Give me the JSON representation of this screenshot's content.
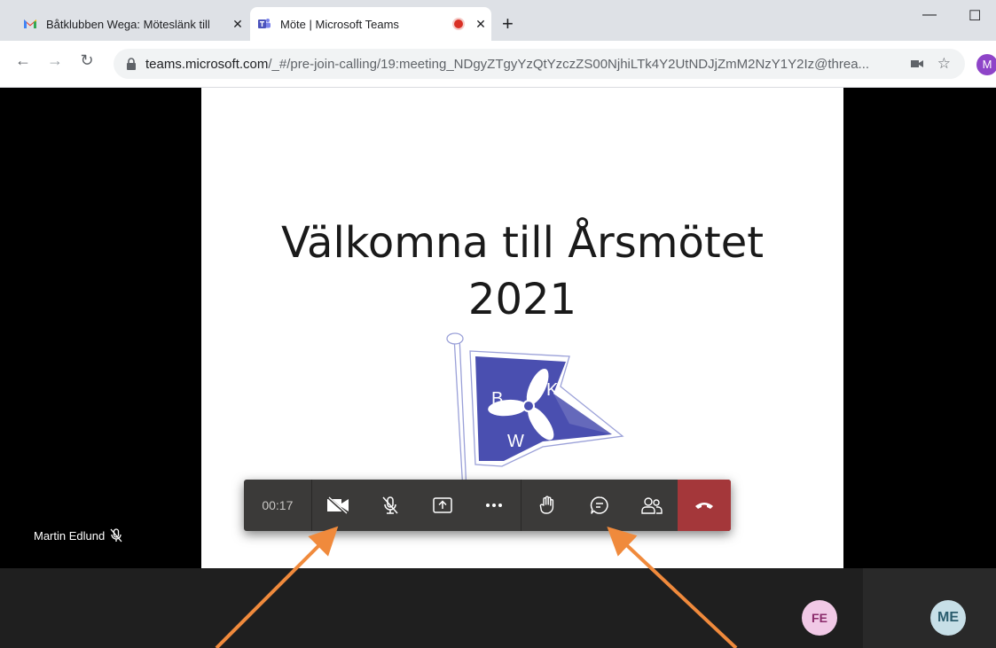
{
  "browser": {
    "tabs": [
      {
        "title": "Båtklubben Wega: Möteslänk till",
        "icon": "gmail-icon"
      },
      {
        "title": "Möte | Microsoft Teams",
        "icon": "teams-icon",
        "recording": true
      }
    ],
    "new_tab": "+",
    "window_controls": {
      "minimize": "—",
      "maximize": "☐"
    },
    "url_host": "teams.microsoft.com",
    "url_path": "/_#/pre-join-calling/19:meeting_NDgyZTgyYzQtYzczZS00NjhiLTk4Y2UtNDJjZmM2NzY1Y2Iz@threa...",
    "profile_initial": "M"
  },
  "slide": {
    "title_line1": "Välkomna till Årsmötet",
    "title_line2": "2021",
    "logo_letters": {
      "left": "B",
      "right": "K",
      "bottom": "W"
    }
  },
  "participant": {
    "name": "Martin Edlund"
  },
  "call_controls": {
    "timer": "00:17",
    "buttons": [
      "camera-off-icon",
      "mic-off-icon",
      "share-screen-icon",
      "more-icon",
      "raise-hand-icon",
      "chat-icon",
      "participants-icon",
      "hang-up-icon"
    ]
  },
  "avatars": [
    {
      "initials": "FE",
      "color": "#f1c9e6"
    },
    {
      "initials": "ME",
      "color": "#c7dfe7"
    }
  ],
  "colors": {
    "accent_hangup": "#a4373a",
    "annotation_arrow": "#f08a3c",
    "logo_blue": "#4a4fb0"
  }
}
